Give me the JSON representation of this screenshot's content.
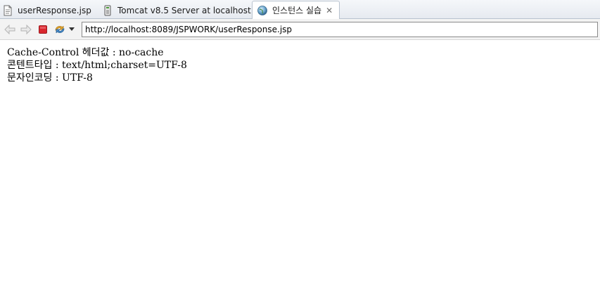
{
  "tabs": [
    {
      "label": "userResponse.jsp",
      "icon": "jsp-file-icon"
    },
    {
      "label": "Tomcat v8.5 Server at localhost",
      "icon": "server-icon"
    },
    {
      "label": "인스턴스 실습",
      "icon": "globe-icon",
      "active": true
    }
  ],
  "toolbar": {
    "back_icon": "back-arrow-icon",
    "forward_icon": "forward-arrow-icon",
    "stop_icon": "stop-icon",
    "refresh_icon": "refresh-icon",
    "url": "http://localhost:8089/JSPWORK/userResponse.jsp"
  },
  "page": {
    "lines": [
      "Cache-Control 헤더값 : no-cache",
      "콘텐트타입 : text/html;charset=UTF-8",
      "문자인코딩 : UTF-8"
    ]
  },
  "colors": {
    "stop": "#d9272e",
    "globe": "#3f7fb6"
  }
}
